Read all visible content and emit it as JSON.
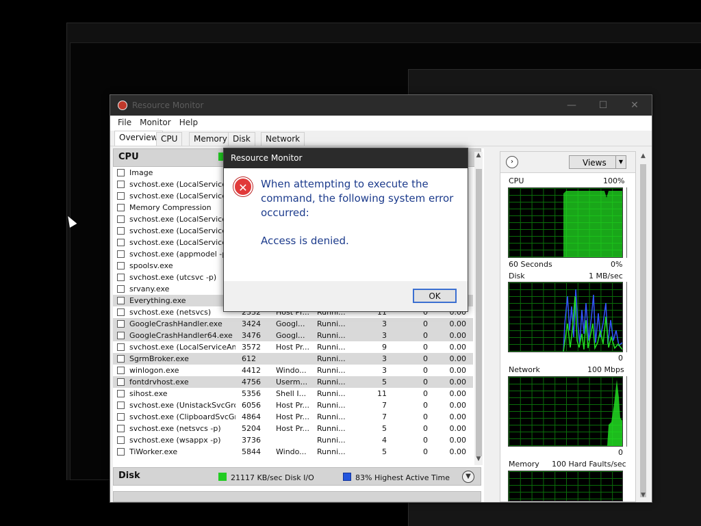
{
  "window": {
    "title": "Resource Monitor",
    "min": "—",
    "max": "☐",
    "close": "✕"
  },
  "menu": [
    "File",
    "Monitor",
    "Help"
  ],
  "tabs": [
    "Overview",
    "CPU",
    "Memory",
    "Disk",
    "Network"
  ],
  "cpu_section": {
    "title": "CPU"
  },
  "process_header": {
    "image": "Image"
  },
  "processes": [
    {
      "name": "svchost.exe (LocalServiceNe",
      "pid": "",
      "desc": "",
      "status": "",
      "threads": "",
      "cpu": "",
      "avg": "",
      "sel": false
    },
    {
      "name": "svchost.exe (LocalService -p",
      "pid": "",
      "desc": "",
      "status": "",
      "threads": "",
      "cpu": "",
      "avg": "",
      "sel": false
    },
    {
      "name": "Memory Compression",
      "pid": "",
      "desc": "",
      "status": "",
      "threads": "",
      "cpu": "",
      "avg": "",
      "sel": false
    },
    {
      "name": "svchost.exe (LocalServiceNe",
      "pid": "",
      "desc": "",
      "status": "",
      "threads": "",
      "cpu": "",
      "avg": "",
      "sel": false
    },
    {
      "name": "svchost.exe (LocalServiceNe",
      "pid": "",
      "desc": "",
      "status": "",
      "threads": "",
      "cpu": "",
      "avg": "",
      "sel": false
    },
    {
      "name": "svchost.exe (LocalServiceNe",
      "pid": "",
      "desc": "",
      "status": "",
      "threads": "",
      "cpu": "",
      "avg": "",
      "sel": false
    },
    {
      "name": "svchost.exe (appmodel -p)",
      "pid": "",
      "desc": "",
      "status": "",
      "threads": "",
      "cpu": "",
      "avg": "",
      "sel": false
    },
    {
      "name": "spoolsv.exe",
      "pid": "",
      "desc": "",
      "status": "",
      "threads": "",
      "cpu": "",
      "avg": "",
      "sel": false
    },
    {
      "name": "svchost.exe (utcsvc -p)",
      "pid": "",
      "desc": "",
      "status": "",
      "threads": "",
      "cpu": "",
      "avg": "",
      "sel": false
    },
    {
      "name": "srvany.exe",
      "pid": "",
      "desc": "",
      "status": "",
      "threads": "",
      "cpu": "",
      "avg": "",
      "sel": false
    },
    {
      "name": "Everything.exe",
      "pid": "",
      "desc": "",
      "status": "",
      "threads": "",
      "cpu": "",
      "avg": "",
      "sel": true
    },
    {
      "name": "svchost.exe (netsvcs)",
      "pid": "2332",
      "desc": "Host Pr...",
      "status": "Runni...",
      "threads": "11",
      "cpu": "0",
      "avg": "0.00",
      "sel": false
    },
    {
      "name": "GoogleCrashHandler.exe",
      "pid": "3424",
      "desc": "Googl...",
      "status": "Runni...",
      "threads": "3",
      "cpu": "0",
      "avg": "0.00",
      "sel": true
    },
    {
      "name": "GoogleCrashHandler64.exe",
      "pid": "3476",
      "desc": "Googl...",
      "status": "Runni...",
      "threads": "3",
      "cpu": "0",
      "avg": "0.00",
      "sel": true
    },
    {
      "name": "svchost.exe (LocalServiceAn...",
      "pid": "3572",
      "desc": "Host Pr...",
      "status": "Runni...",
      "threads": "9",
      "cpu": "0",
      "avg": "0.00",
      "sel": false
    },
    {
      "name": "SgrmBroker.exe",
      "pid": "612",
      "desc": "",
      "status": "Runni...",
      "threads": "3",
      "cpu": "0",
      "avg": "0.00",
      "sel": true
    },
    {
      "name": "winlogon.exe",
      "pid": "4412",
      "desc": "Windo...",
      "status": "Runni...",
      "threads": "3",
      "cpu": "0",
      "avg": "0.00",
      "sel": false
    },
    {
      "name": "fontdrvhost.exe",
      "pid": "4756",
      "desc": "Userm...",
      "status": "Runni...",
      "threads": "5",
      "cpu": "0",
      "avg": "0.00",
      "sel": true
    },
    {
      "name": "sihost.exe",
      "pid": "5356",
      "desc": "Shell I...",
      "status": "Runni...",
      "threads": "11",
      "cpu": "0",
      "avg": "0.00",
      "sel": false
    },
    {
      "name": "svchost.exe (UnistackSvcGro...",
      "pid": "6056",
      "desc": "Host Pr...",
      "status": "Runni...",
      "threads": "7",
      "cpu": "0",
      "avg": "0.00",
      "sel": false
    },
    {
      "name": "svchost.exe (ClipboardSvcGr...",
      "pid": "4864",
      "desc": "Host Pr...",
      "status": "Runni...",
      "threads": "7",
      "cpu": "0",
      "avg": "0.00",
      "sel": false
    },
    {
      "name": "svchost.exe (netsvcs -p)",
      "pid": "5204",
      "desc": "Host Pr...",
      "status": "Runni...",
      "threads": "5",
      "cpu": "0",
      "avg": "0.00",
      "sel": false
    },
    {
      "name": "svchost.exe (wsappx -p)",
      "pid": "3736",
      "desc": "",
      "status": "Runni...",
      "threads": "4",
      "cpu": "0",
      "avg": "0.00",
      "sel": false
    },
    {
      "name": "TiWorker.exe",
      "pid": "5844",
      "desc": "Windo...",
      "status": "Runni...",
      "threads": "5",
      "cpu": "0",
      "avg": "0.00",
      "sel": false
    }
  ],
  "disk_section": {
    "title": "Disk",
    "io": "21117 KB/sec Disk I/O",
    "active": "83% Highest Active Time",
    "io_color": "#22cc22",
    "active_color": "#2255dd"
  },
  "right_panel": {
    "views_label": "Views",
    "cpu_label": "CPU",
    "cpu_max": "100%",
    "cpu_time": "60 Seconds",
    "cpu_min": "0%",
    "disk_label": "Disk",
    "disk_max": "1 MB/sec",
    "disk_min": "0",
    "network_label": "Network",
    "network_max": "100 Mbps",
    "network_min": "0",
    "memory_label": "Memory",
    "memory_max": "100 Hard Faults/sec"
  },
  "dialog": {
    "title": "Resource Monitor",
    "message": "When attempting to execute the command, the following system error occurred:",
    "detail": "Access is denied.",
    "ok": "OK"
  },
  "colors": {
    "graph_green": "#22dd22",
    "graph_blue": "#3355ff",
    "dialog_text": "#1c3b8c"
  }
}
